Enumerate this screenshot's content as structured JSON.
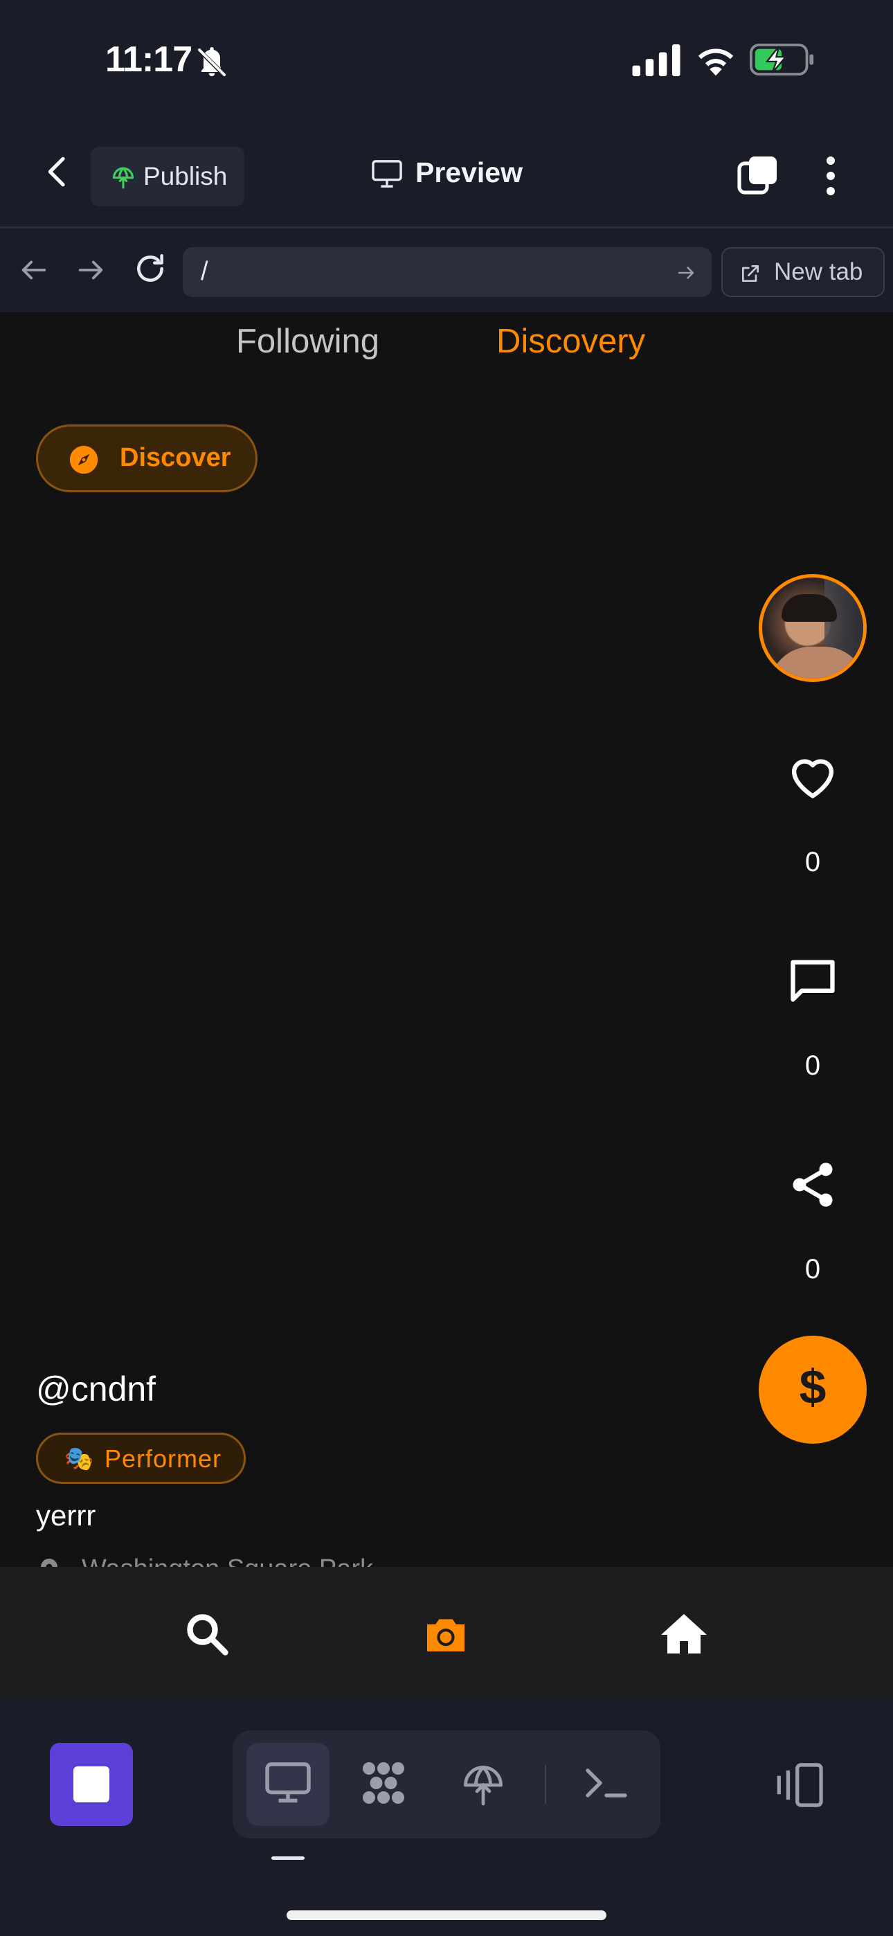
{
  "status_bar": {
    "time": "11:17",
    "icons": [
      "bell-slash-icon",
      "cellular-signal-icon",
      "wifi-icon",
      "battery-charging-icon"
    ]
  },
  "topbar": {
    "publish_label": "Publish",
    "preview_label": "Preview"
  },
  "browser": {
    "url": "/",
    "new_tab_label": "New tab"
  },
  "feed": {
    "tabs": [
      {
        "label": "Following",
        "active": false
      },
      {
        "label": "Discovery",
        "active": true
      }
    ],
    "discover_label": "Discover",
    "post": {
      "username": "@cndnf",
      "role_emoji": "🎭",
      "role": "Performer",
      "caption": "yerrr",
      "location": "Washington Square Park",
      "likes": "0",
      "comments": "0",
      "shares": "0",
      "tip_symbol": "$"
    }
  },
  "colors": {
    "accent": "#ff8a00",
    "app_background": "#121212",
    "ide_background": "#1a1c27",
    "stop_button": "#5b3fd6"
  }
}
